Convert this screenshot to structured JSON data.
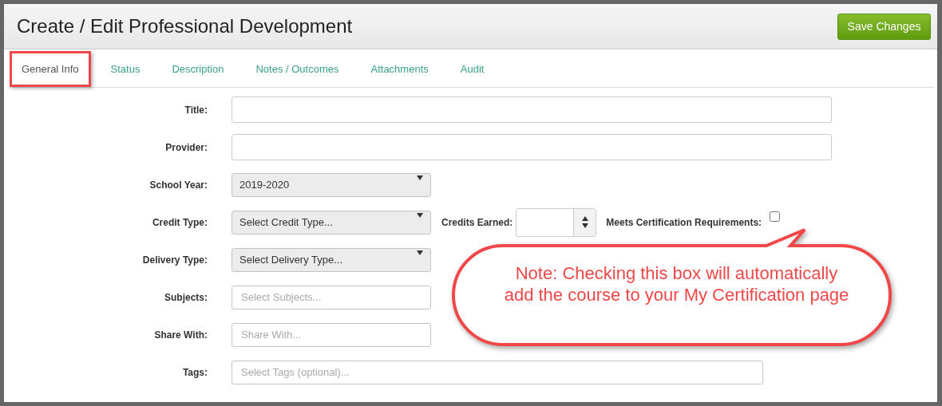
{
  "header": {
    "title": "Create / Edit Professional Development",
    "save_button": "Save Changes"
  },
  "tabs": [
    {
      "label": "General Info",
      "selected": true
    },
    {
      "label": "Status",
      "selected": false
    },
    {
      "label": "Description",
      "selected": false
    },
    {
      "label": "Notes / Outcomes",
      "selected": false
    },
    {
      "label": "Attachments",
      "selected": false
    },
    {
      "label": "Audit",
      "selected": false
    }
  ],
  "form": [
    {
      "label": "Title:",
      "kind": "text"
    },
    {
      "label": "Provider:",
      "kind": "text"
    },
    {
      "label": "School Year:",
      "kind": "select",
      "value": "2019-2020"
    },
    {
      "label": "Credit Type:",
      "kind": "select",
      "value": "Select Credit Type...",
      "credits_earned": {
        "label": "Credits Earned:"
      },
      "certification": {
        "label": "Meets Certification Requirements:",
        "checked": false
      }
    },
    {
      "label": "Delivery Type:",
      "kind": "select",
      "value": "Select Delivery Type..."
    },
    {
      "label": "Subjects:",
      "kind": "multi",
      "placeholder": "Select Subjects..."
    },
    {
      "label": "Share With:",
      "kind": "multi",
      "placeholder": "Share With..."
    },
    {
      "label": "Tags:",
      "kind": "tags",
      "placeholder": "Select Tags (optional)..."
    }
  ],
  "callout": {
    "text": "Note: Checking this box will automatically add the course to your My Certification page"
  }
}
